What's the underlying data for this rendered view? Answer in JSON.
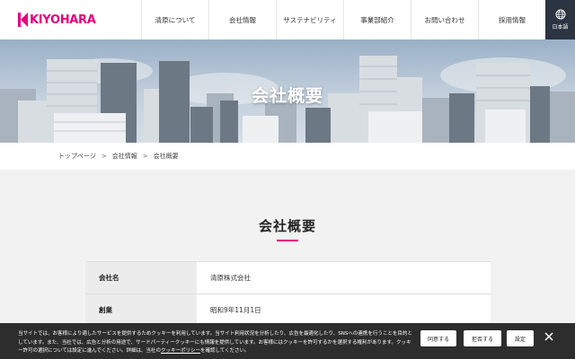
{
  "header": {
    "logo_text": "KIYOHARA",
    "nav": [
      {
        "label": "清原について"
      },
      {
        "label": "会社情報"
      },
      {
        "label": "サステナビリティ"
      },
      {
        "label": "事業部紹介"
      },
      {
        "label": "お問い合わせ"
      },
      {
        "label": "採用情報"
      }
    ],
    "lang_label": "日本語",
    "lang_icon": "globe-icon"
  },
  "hero": {
    "title": "会社概要"
  },
  "breadcrumb": {
    "items": [
      "トップページ",
      "会社情報",
      "会社概要"
    ],
    "separator": ">"
  },
  "main": {
    "section_title": "会社概要",
    "table": [
      {
        "label": "会社名",
        "value": "清原株式会社"
      },
      {
        "label": "創業",
        "value": "昭和9年11月1日"
      }
    ]
  },
  "cookie": {
    "text_part1": "当サイトでは、お客様により適したサービスを提供するためクッキーを利用しています。当サイト利用状況を分析したり、広告を最適化したり、SNSへの連携を行うことを目的としています。また、当社では、広告と分析の用途で、サードパーティークッキーにも情報を提供しています。お客様にはクッキーを許可するかを選択する権利があります。クッキー許可の選択については設定に進んでください。詳細は、当社の",
    "link_text": "クッキーポリシー",
    "text_part2": "を確認してください。",
    "accept_label": "同意する",
    "reject_label": "拒否する",
    "settings_label": "設定",
    "close_icon": "close-icon"
  },
  "colors": {
    "brand": "#e6007e",
    "header_lang_bg": "#2b3440",
    "cookie_bg": "#1e1e1e"
  }
}
